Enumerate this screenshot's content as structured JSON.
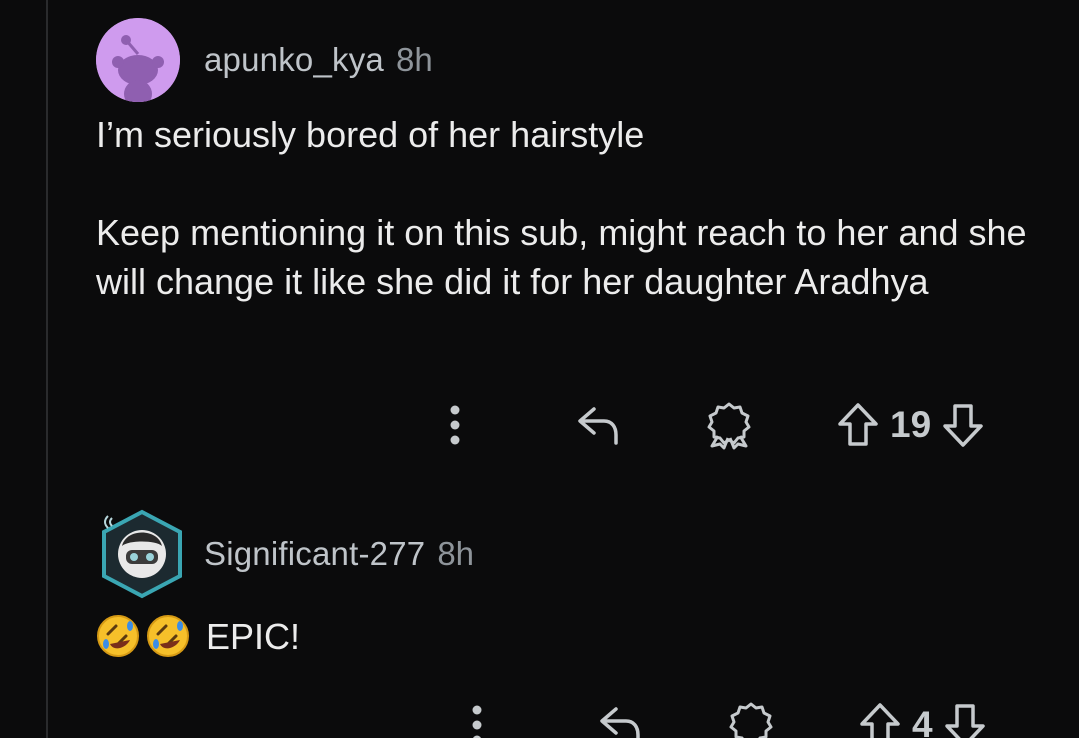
{
  "comments": [
    {
      "username": "apunko_kya",
      "time": "8h",
      "paragraphs": [
        "I’m seriously bored of her hairstyle",
        "Keep mentioning it on this sub, might reach to her and she will change it like she did it for her daughter Aradhya"
      ],
      "score": "19",
      "avatar_color": "#cf9bee",
      "icons": [
        "more-options-icon",
        "reply-icon",
        "award-icon",
        "upvote-icon",
        "downvote-icon"
      ]
    },
    {
      "username": "Significant-277",
      "time": "8h",
      "text": "EPIC!",
      "emojis": [
        "rolling-on-floor-laughing-emoji",
        "rolling-on-floor-laughing-emoji"
      ],
      "score": "4",
      "avatar_color": "#3aa6b3",
      "icons": [
        "more-options-icon",
        "reply-icon",
        "award-icon",
        "upvote-icon",
        "downvote-icon"
      ]
    }
  ],
  "colors": {
    "background": "#0b0b0c",
    "text": "#ececec",
    "muted": "#8e949a",
    "thread_line": "#2a2b2d"
  }
}
